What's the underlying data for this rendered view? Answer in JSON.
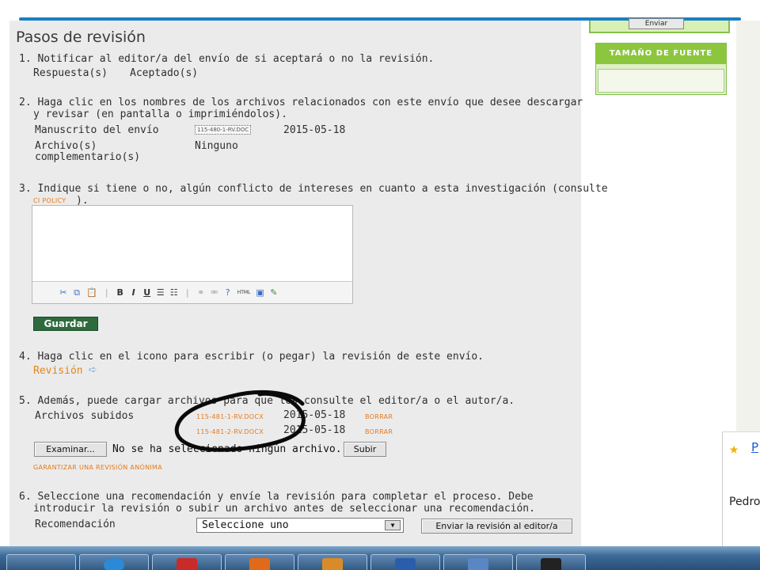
{
  "page": {
    "title": "Pasos de revisión"
  },
  "steps": {
    "s1": {
      "text": "1. Notificar al editor/a del envío de si aceptará o no la revisión.",
      "respuesta_label": "Respuesta(s)",
      "respuesta_value": "Aceptado(s)"
    },
    "s2": {
      "line1": "2. Haga clic en los nombres de los archivos relacionados con este envío que desee descargar",
      "line2": "y revisar (en pantalla o imprimiéndolos).",
      "manuscrito_label": "Manuscrito del envío",
      "manuscrito_file": "115-480-1-RV.DOC",
      "manuscrito_date": "2015-05-18",
      "archivo_label_1": "Archivo(s)",
      "archivo_label_2": "complementario(s)",
      "archivo_value": "Ninguno"
    },
    "s3": {
      "line1": "3. Indique si tiene o no, algún conflicto de intereses en cuanto a esta investigación (consulte",
      "link": "CI POLICY",
      "line2_suffix": ").",
      "save_button": "Guardar"
    },
    "s4": {
      "text": "4. Haga clic en el icono para escribir (o pegar) la revisión de este envío.",
      "link": "Revisión"
    },
    "s5": {
      "text": "5. Además, puede cargar archivos para que los consulte el editor/a o el autor/a.",
      "subidos_label": "Archivos subidos",
      "files": [
        {
          "name": "115-481-1-RV.DOCX",
          "date": "2015-05-18",
          "action": "BORRAR"
        },
        {
          "name": "115-481-2-RV.DOCX",
          "date": "2015-05-18",
          "action": "BORRAR"
        }
      ],
      "browse_button": "Examinar...",
      "no_file_text": "No se ha seleccionado ningún archivo.",
      "upload_button": "Subir",
      "anon_link": "GARANTIZAR UNA REVISIÓN ANÓNIMA"
    },
    "s6": {
      "line1": "6. Seleccione una recomendación y envíe la revisión para completar el proceso. Debe",
      "line2": "introducir la revisión o subir un archivo antes de seleccionar una recomendación.",
      "rec_label": "Recomendación",
      "select_value": "Seleccione uno",
      "send_button": "Enviar la revisión al editor/a"
    }
  },
  "sidebar": {
    "send_button": "Enviar",
    "font_size_title": "TAMAÑO DE FUENTE"
  },
  "popup": {
    "link_initial": "P",
    "name_partial": "Pedro"
  },
  "editor_toolbar": {
    "cut": "✂",
    "copy": "⧉",
    "paste": "📋",
    "bold": "B",
    "italic": "I",
    "underline": "U",
    "bullets": "☰",
    "numbered": "☷",
    "link": "⚭",
    "unlink": "⚮",
    "help": "?",
    "html": "HTML",
    "image": "▣",
    "extra": "✎"
  },
  "colors": {
    "accent_blue": "#1b7fc1",
    "link_orange": "#e87a18",
    "save_green": "#2d6b3c",
    "sidebar_green": "#8cc63f"
  }
}
